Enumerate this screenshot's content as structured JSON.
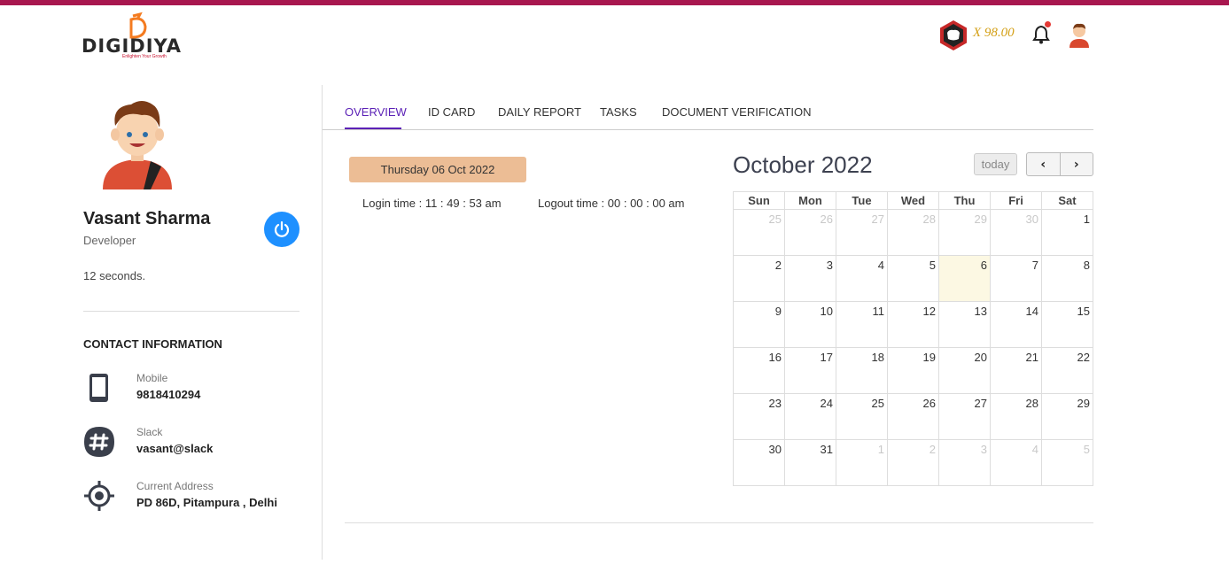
{
  "brand": {
    "name": "DIGIDIYA",
    "tagline": "Enlighten Your Growth"
  },
  "header": {
    "coin_value": "X 98.00"
  },
  "profile": {
    "name": "Vasant Sharma",
    "role": "Developer",
    "elapsed": "12 seconds."
  },
  "contact": {
    "title": "CONTACT INFORMATION",
    "items": [
      {
        "label": "Mobile",
        "value": "9818410294",
        "icon": "mobile-icon"
      },
      {
        "label": "Slack",
        "value": "vasant@slack",
        "icon": "slack-icon"
      },
      {
        "label": "Current Address",
        "value": "PD 86D, Pitampura , Delhi",
        "icon": "location-icon"
      }
    ]
  },
  "tabs": [
    {
      "label": "OVERVIEW",
      "active": true
    },
    {
      "label": "ID CARD"
    },
    {
      "label": "DAILY REPORT"
    },
    {
      "label": "TASKS"
    },
    {
      "label": "DOCUMENT VERIFICATION"
    }
  ],
  "attendance": {
    "date": "Thursday 06 Oct 2022",
    "login": "Login time : 11 : 49 : 53 am",
    "logout": "Logout time : 00 : 00 : 00 am"
  },
  "calendar": {
    "title": "October 2022",
    "today_label": "today",
    "weekdays": [
      "Sun",
      "Mon",
      "Tue",
      "Wed",
      "Thu",
      "Fri",
      "Sat"
    ],
    "weeks": [
      [
        "25",
        "26",
        "27",
        "28",
        "29",
        "30",
        "1"
      ],
      [
        "2",
        "3",
        "4",
        "5",
        "6",
        "7",
        "8"
      ],
      [
        "9",
        "10",
        "11",
        "12",
        "13",
        "14",
        "15"
      ],
      [
        "16",
        "17",
        "18",
        "19",
        "20",
        "21",
        "22"
      ],
      [
        "23",
        "24",
        "25",
        "26",
        "27",
        "28",
        "29"
      ],
      [
        "30",
        "31",
        "1",
        "2",
        "3",
        "4",
        "5"
      ]
    ],
    "today": "6"
  },
  "colors": {
    "topbar": "#a8174f",
    "accent": "#5b21b6",
    "power": "#1e90ff",
    "date_pill": "#ecbd95",
    "today_cell": "#fcf8e3"
  }
}
